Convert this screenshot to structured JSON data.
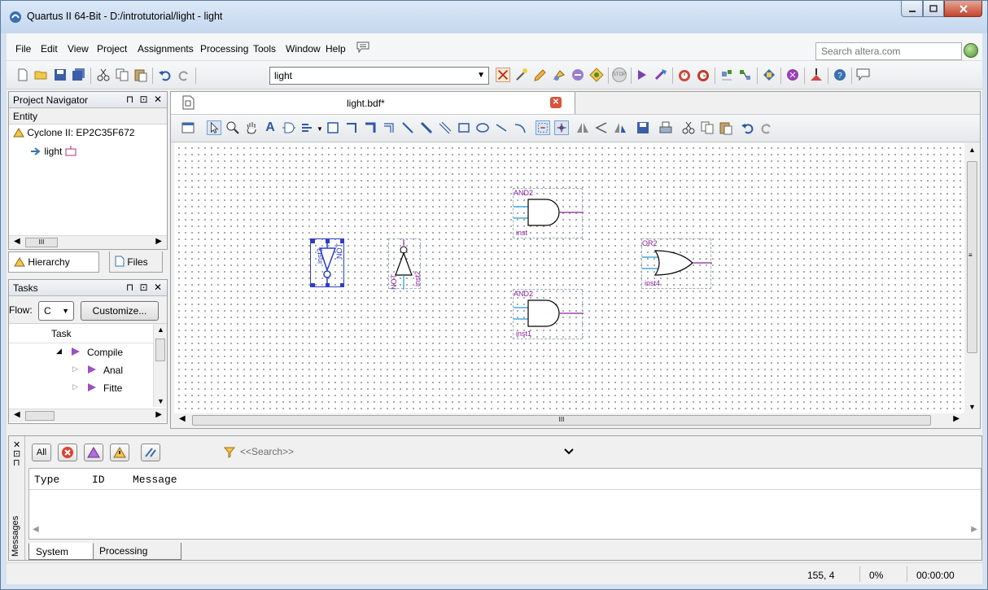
{
  "window": {
    "title": "Quartus II 64-Bit - D:/introtutorial/light - light"
  },
  "menu": [
    "File",
    "Edit",
    "View",
    "Project",
    "Assignments",
    "Processing",
    "Tools",
    "Window",
    "Help"
  ],
  "search": {
    "placeholder": "Search altera.com"
  },
  "toolbar": {
    "project_value": "light",
    "stop_label": "STOP"
  },
  "project_navigator": {
    "title": "Project Navigator",
    "column": "Entity",
    "device": "Cyclone II: EP2C35F672",
    "entity": "light",
    "tabs": [
      "Hierarchy",
      "Files"
    ]
  },
  "tasks": {
    "title": "Tasks",
    "flow_label": "Flow:",
    "flow_value": "C",
    "customize": "Customize...",
    "column": "Task",
    "rows": [
      "Compile",
      "Anal",
      "Fitte"
    ]
  },
  "document": {
    "tab": "light.bdf*",
    "gates": [
      {
        "type": "AND2",
        "instance": "inst"
      },
      {
        "type": "AND2",
        "instance": "inst1"
      },
      {
        "type": "OR2",
        "instance": "inst4"
      },
      {
        "type": "NOT",
        "instance": "inst2"
      },
      {
        "type": "NOT",
        "instance": "inst3"
      }
    ],
    "scroll_marker": "III"
  },
  "messages": {
    "side_label": "Messages",
    "all": "All",
    "search_placeholder": "<<Search>>",
    "columns": [
      "Type",
      "ID",
      "Message"
    ],
    "tabs": [
      "System",
      "Processing"
    ]
  },
  "status": {
    "coords": "155, 4",
    "progress": "0%",
    "time": "00:00:00"
  },
  "colors": {
    "wire": "#1e9bd7",
    "output": "#8a1f9e",
    "accent": "#2b5aa6"
  }
}
